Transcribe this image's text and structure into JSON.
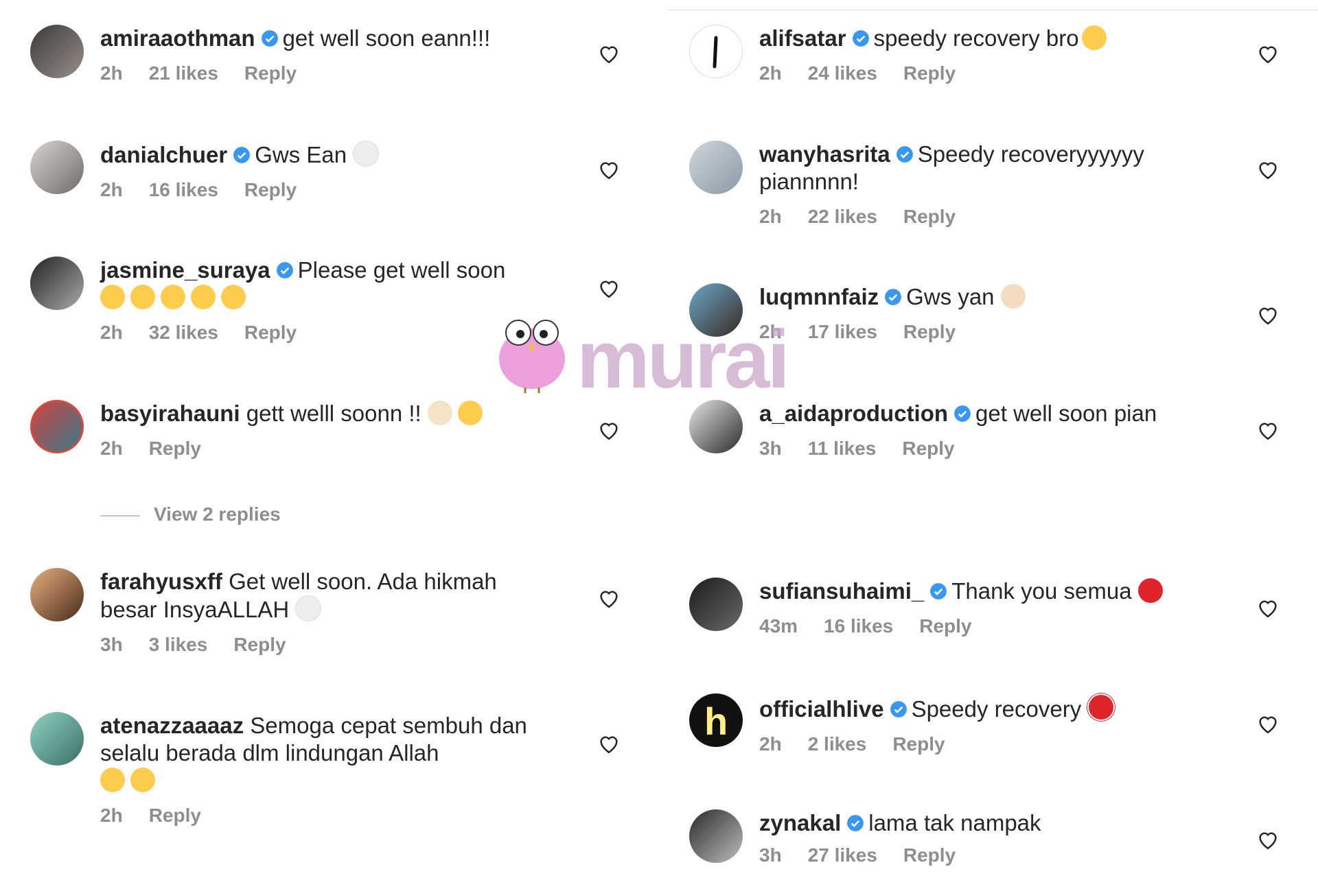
{
  "watermark": "murai",
  "colors": {
    "verified": "#3897f0",
    "meta": "#8e8e8e",
    "text": "#262626"
  },
  "left": [
    {
      "user": "amiraaothman",
      "verified": true,
      "text": "get well soon eann!!!",
      "emojis": [],
      "time": "2h",
      "likes": "21 likes",
      "reply": "Reply"
    },
    {
      "user": "danialchuer",
      "verified": true,
      "text": "Gws Ean",
      "emojis": [
        "white-heart"
      ],
      "time": "2h",
      "likes": "16 likes",
      "reply": "Reply"
    },
    {
      "user": "jasmine_suraya",
      "verified": true,
      "text": "Please get well soon",
      "emojis": [
        "pleading-face",
        "pleading-face",
        "pleading-face",
        "pleading-face",
        "pleading-face"
      ],
      "time": "2h",
      "likes": "32 likes",
      "reply": "Reply"
    },
    {
      "user": "basyirahauni",
      "verified": false,
      "text": "gett welll soonn !!",
      "emojis": [
        "raising-hands",
        "pleading-face"
      ],
      "time": "2h",
      "likes": "",
      "reply": "Reply",
      "view_replies": "View 2 replies"
    },
    {
      "user": "farahyusxff",
      "verified": false,
      "text": "Get well soon. Ada hikmah besar InsyaALLAH",
      "emojis": [
        "white-heart"
      ],
      "time": "3h",
      "likes": "3 likes",
      "reply": "Reply"
    },
    {
      "user": "atenazzaaaaz",
      "verified": false,
      "text": "Semoga cepat sembuh dan selalu berada dlm lindungan Allah",
      "emojis": [
        "open-hands",
        "flexed-biceps"
      ],
      "time": "2h",
      "likes": "",
      "reply": "Reply"
    }
  ],
  "right": [
    {
      "user": "alifsatar",
      "verified": true,
      "text": "speedy recovery bro",
      "emojis": [
        "raising-hands"
      ],
      "time": "2h",
      "likes": "24 likes",
      "reply": "Reply"
    },
    {
      "user": "wanyhasrita",
      "verified": true,
      "text": "Speedy recoveryyyyyy piannnnn!",
      "emojis": [],
      "time": "2h",
      "likes": "22 likes",
      "reply": "Reply"
    },
    {
      "user": "luqmnnfaiz",
      "verified": true,
      "text": "Gws yan",
      "emojis": [
        "folded-hands"
      ],
      "time": "2h",
      "likes": "17 likes",
      "reply": "Reply"
    },
    {
      "user": "a_aidaproduction",
      "verified": true,
      "text": "get well soon pian",
      "emojis": [],
      "time": "3h",
      "likes": "11 likes",
      "reply": "Reply"
    },
    {
      "user": "sufiansuhaimi_",
      "verified": true,
      "text": "Thank you semua",
      "emojis": [
        "red-heart"
      ],
      "time": "43m",
      "likes": "16 likes",
      "reply": "Reply"
    },
    {
      "user": "officialhlive",
      "verified": true,
      "text": "Speedy recovery",
      "emojis": [
        "mending-heart"
      ],
      "time": "2h",
      "likes": "2 likes",
      "reply": "Reply"
    },
    {
      "user": "zynakal",
      "verified": true,
      "text": "lama tak nampak",
      "emojis": [],
      "time": "3h",
      "likes": "27 likes",
      "reply": "Reply"
    }
  ]
}
